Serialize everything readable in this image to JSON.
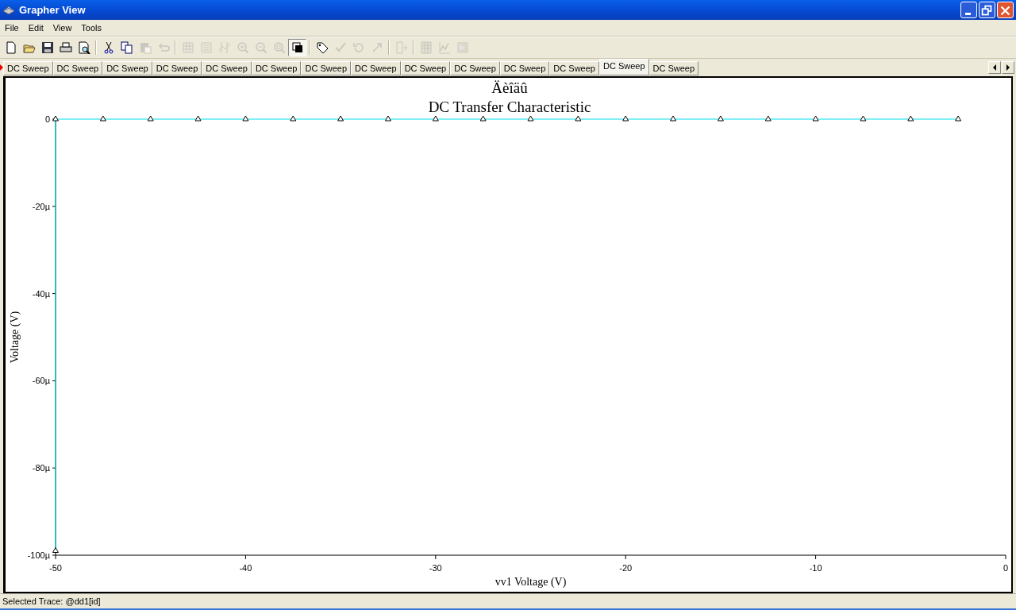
{
  "window": {
    "title": "Grapher View"
  },
  "menu": [
    "File",
    "Edit",
    "View",
    "Tools"
  ],
  "toolbar": [
    [
      {
        "kind": "new",
        "disabled": false
      },
      {
        "kind": "open",
        "disabled": false
      },
      {
        "kind": "save",
        "disabled": false
      },
      {
        "kind": "print",
        "disabled": false
      },
      {
        "kind": "preview",
        "disabled": false
      }
    ],
    [
      {
        "kind": "cut",
        "disabled": false
      },
      {
        "kind": "copy",
        "disabled": false
      },
      {
        "kind": "paste",
        "disabled": true
      },
      {
        "kind": "undo",
        "disabled": true
      }
    ],
    [
      {
        "kind": "grid",
        "disabled": true
      },
      {
        "kind": "legend",
        "disabled": true
      },
      {
        "kind": "cursors",
        "disabled": true
      },
      {
        "kind": "zoom-in",
        "disabled": true
      },
      {
        "kind": "zoom-out",
        "disabled": true
      },
      {
        "kind": "zoom-fit",
        "disabled": true
      },
      {
        "kind": "overlay",
        "disabled": false,
        "pressed": true
      }
    ],
    [
      {
        "kind": "tag",
        "disabled": false
      },
      {
        "kind": "check",
        "disabled": true
      },
      {
        "kind": "rotate",
        "disabled": true
      },
      {
        "kind": "arrow",
        "disabled": true
      }
    ],
    [
      {
        "kind": "export",
        "disabled": true
      }
    ],
    [
      {
        "kind": "sheet",
        "disabled": true
      },
      {
        "kind": "plot",
        "disabled": true
      },
      {
        "kind": "shade",
        "disabled": true
      }
    ]
  ],
  "tabs": [
    {
      "label": "DC Sweep",
      "selected": false
    },
    {
      "label": "DC Sweep",
      "selected": false
    },
    {
      "label": "DC Sweep",
      "selected": false
    },
    {
      "label": "DC Sweep",
      "selected": false
    },
    {
      "label": "DC Sweep",
      "selected": false
    },
    {
      "label": "DC Sweep",
      "selected": false
    },
    {
      "label": "DC Sweep",
      "selected": false
    },
    {
      "label": "DC Sweep",
      "selected": false
    },
    {
      "label": "DC Sweep",
      "selected": false
    },
    {
      "label": "DC Sweep",
      "selected": false
    },
    {
      "label": "DC Sweep",
      "selected": false
    },
    {
      "label": "DC Sweep",
      "selected": false
    },
    {
      "label": "DC Sweep",
      "selected": true
    },
    {
      "label": "DC Sweep",
      "selected": false
    }
  ],
  "graph": {
    "chart_data": {
      "type": "line",
      "title": "Äèîäû\nDC Transfer Characteristic",
      "xlabel": "vv1 Voltage (V)",
      "ylabel": "Voltage (V)",
      "x": [
        -50,
        -50,
        -47.5,
        -45,
        -42.5,
        -40,
        -37.5,
        -35,
        -32.5,
        -30,
        -27.5,
        -25,
        -22.5,
        -20,
        -17.5,
        -15,
        -12.5,
        -10,
        -7.5,
        -5,
        -2.5
      ],
      "series": [
        {
          "color": "#00e0e8",
          "marker": "triangle",
          "values": [
            -99,
            0,
            0,
            0,
            0,
            0,
            0,
            0,
            0,
            0,
            0,
            0,
            0,
            0,
            0,
            0,
            0,
            0,
            0,
            0,
            0
          ]
        }
      ],
      "xlim": [
        -50,
        0
      ],
      "ylim": [
        -100,
        0
      ],
      "xticks": [
        -50,
        -40,
        -30,
        -20,
        -10,
        0
      ],
      "yticks": [
        0,
        {
          "value": -20,
          "label": "-20µ"
        },
        {
          "value": -40,
          "label": "-40µ"
        },
        {
          "value": -60,
          "label": "-60µ"
        },
        {
          "value": -80,
          "label": "-80µ"
        },
        {
          "value": -100,
          "label": "-100µ"
        }
      ]
    }
  },
  "status_bar": {
    "text": "Selected Trace:  @dd1[id]"
  }
}
